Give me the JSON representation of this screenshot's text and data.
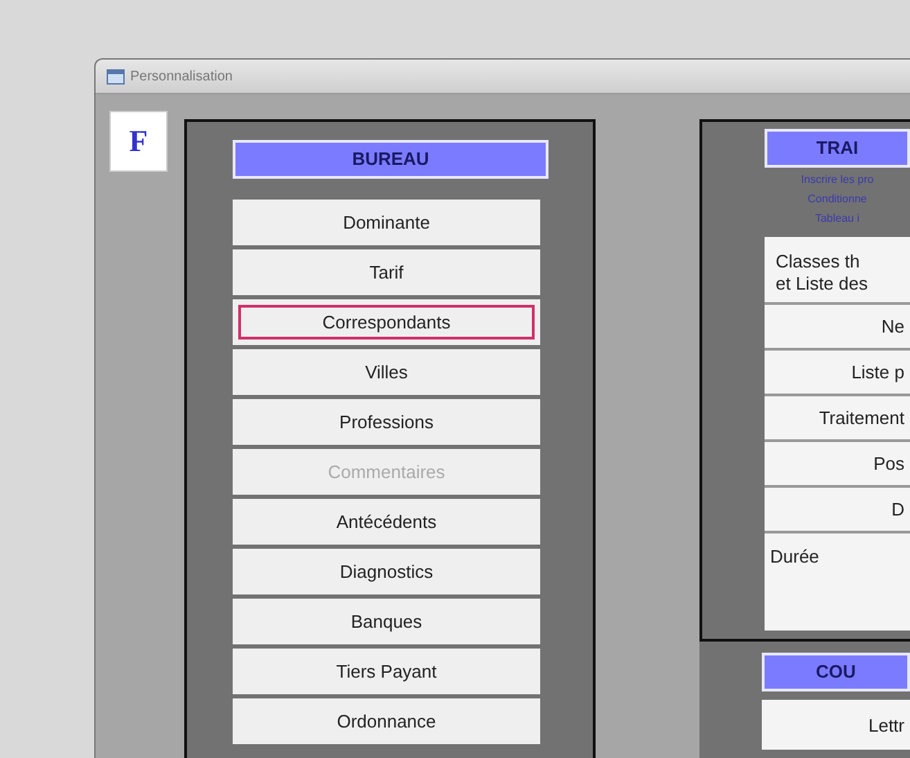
{
  "window": {
    "title": "Personnalisation",
    "badge": "F"
  },
  "bureau": {
    "title": "BUREAU",
    "items": [
      {
        "label": "Dominante",
        "selected": false,
        "disabled": false
      },
      {
        "label": "Tarif",
        "selected": false,
        "disabled": false
      },
      {
        "label": "Correspondants",
        "selected": true,
        "disabled": false
      },
      {
        "label": "Villes",
        "selected": false,
        "disabled": false
      },
      {
        "label": "Professions",
        "selected": false,
        "disabled": false
      },
      {
        "label": "Commentaires",
        "selected": false,
        "disabled": true
      },
      {
        "label": "Antécédents",
        "selected": false,
        "disabled": false
      },
      {
        "label": "Diagnostics",
        "selected": false,
        "disabled": false
      },
      {
        "label": "Banques",
        "selected": false,
        "disabled": false
      },
      {
        "label": "Tiers Payant",
        "selected": false,
        "disabled": false
      },
      {
        "label": "Ordonnance",
        "selected": false,
        "disabled": false
      }
    ]
  },
  "traitements": {
    "title": "TRAI",
    "notes": [
      "Inscrire les pro",
      "Conditionne",
      "Tableau i"
    ],
    "heading": "Classes th\net Liste des",
    "rows": [
      {
        "label": "Ne",
        "kind": "button"
      },
      {
        "label": "Liste p",
        "kind": "button"
      },
      {
        "label": "Traitement",
        "kind": "button"
      },
      {
        "label": "Pos",
        "kind": "button"
      },
      {
        "label": "D",
        "kind": "button"
      },
      {
        "label": "Durée",
        "kind": "label"
      }
    ]
  },
  "courriers": {
    "title": "COU",
    "items": [
      "Lettr"
    ]
  }
}
